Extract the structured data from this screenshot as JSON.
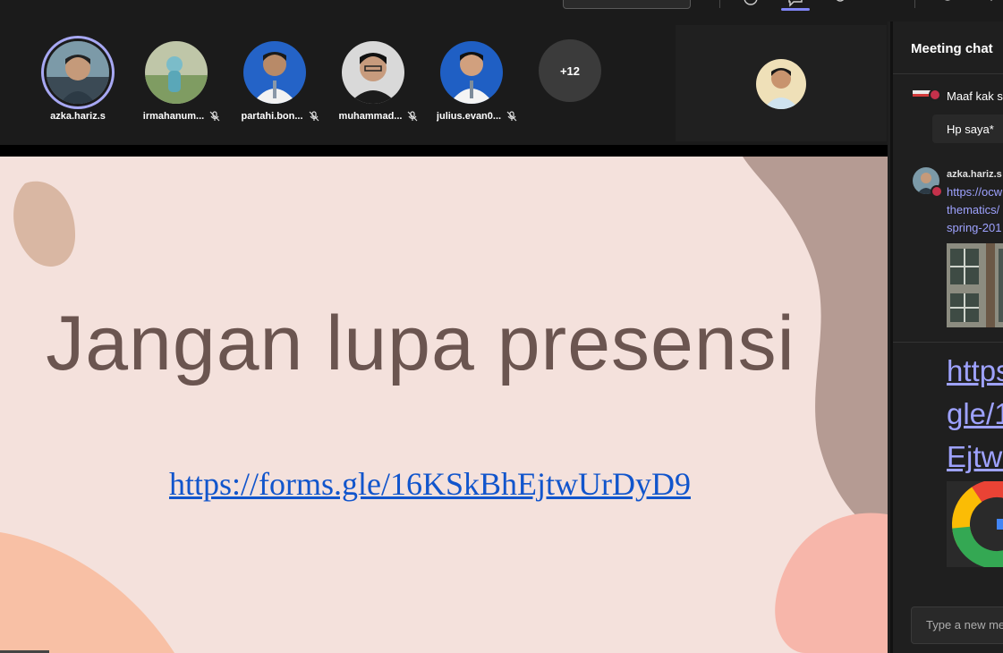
{
  "toolbar": {
    "icons": [
      "reaction-icon",
      "chat-icon",
      "participants-icon",
      "leave-icon",
      "more-icon"
    ],
    "active_accent": "#7f85f5"
  },
  "participants": [
    {
      "name": "azka.hariz.s",
      "muted": false,
      "speaking": true
    },
    {
      "name": "irmahanum...",
      "muted": true,
      "speaking": false
    },
    {
      "name": "partahi.bon...",
      "muted": true,
      "speaking": false
    },
    {
      "name": "muhammad...",
      "muted": true,
      "speaking": false
    },
    {
      "name": "julius.evan0...",
      "muted": true,
      "speaking": false
    }
  ],
  "more_participants": "+12",
  "slide": {
    "title": "Jangan lupa presensi",
    "link": "https://forms.gle/16KSkBhEjtwUrDyD9",
    "link_color": "#1155cc",
    "background": "#f4e1dc"
  },
  "chat": {
    "header": "Meeting chat",
    "messages": [
      {
        "text_1": "Maaf kak s",
        "text_2": "Hp saya*"
      },
      {
        "sender": "azka.hariz.s",
        "link_lines": [
          "https://ocw",
          "thematics/",
          "spring-201"
        ],
        "big_link_lines": [
          "https:",
          "gle/1",
          "EjtwU"
        ]
      }
    ],
    "compose_placeholder": "Type a new me",
    "status_color": "#c4314b",
    "link_color": "#9ea2ff"
  }
}
